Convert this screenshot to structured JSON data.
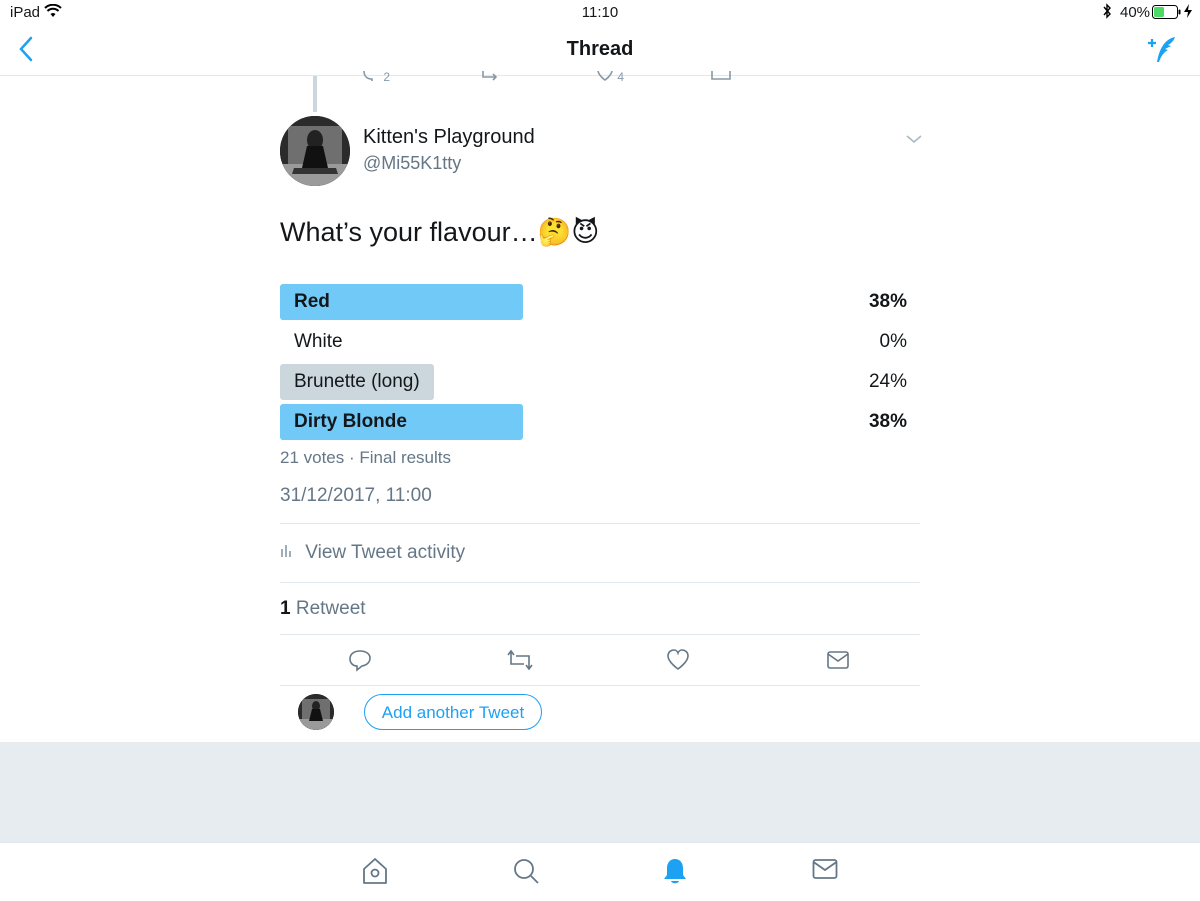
{
  "status_bar": {
    "device": "iPad",
    "time": "11:10",
    "battery": "40%"
  },
  "nav": {
    "title": "Thread"
  },
  "previous_tweet": {
    "reply_count": "2",
    "like_count": "4"
  },
  "tweet": {
    "display_name": "Kitten's Playground",
    "handle": "@Mi55K1tty",
    "text": "What’s your flavour…🤔😈",
    "poll": {
      "options": [
        {
          "label": "Red",
          "percent": "38%",
          "fraction": 0.38,
          "winner": true
        },
        {
          "label": "White",
          "percent": "0%",
          "fraction": 0.0,
          "winner": false
        },
        {
          "label": "Brunette (long)",
          "percent": "24%",
          "fraction": 0.24,
          "winner": false
        },
        {
          "label": "Dirty Blonde",
          "percent": "38%",
          "fraction": 0.38,
          "winner": true
        }
      ],
      "summary": "21 votes · Final results"
    },
    "timestamp": "31/12/2017, 11:00",
    "activity_label": "View Tweet activity",
    "retweet_count": "1",
    "retweet_label": "Retweet"
  },
  "reply_bar": {
    "add_label": "Add another Tweet"
  },
  "colors": {
    "accent": "#1da1f2",
    "poll_winner": "#71c9f8",
    "poll_other": "#ccd6dd",
    "muted": "#657786"
  },
  "tabs": [
    "home-icon",
    "search-icon",
    "notifications-icon",
    "messages-icon"
  ]
}
